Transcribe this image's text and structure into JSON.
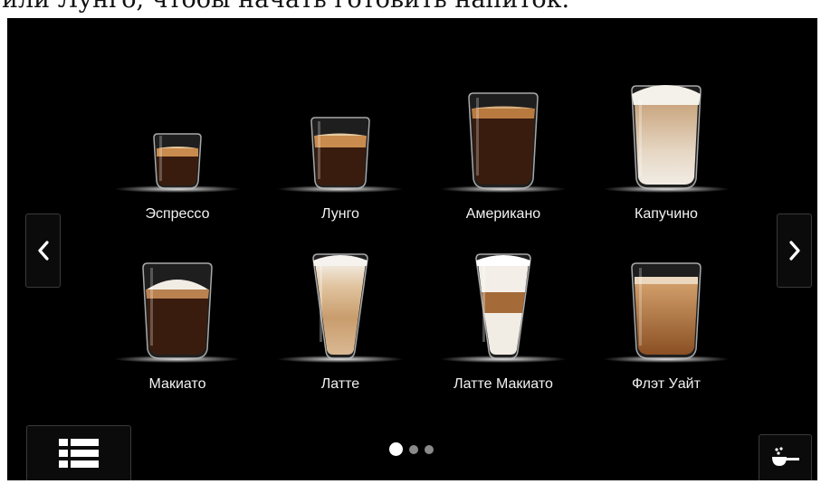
{
  "caption": {
    "text": "или Лунго, чтобы начать готовить напиток."
  },
  "beverages": [
    {
      "label": "Эспрессо"
    },
    {
      "label": "Лунго"
    },
    {
      "label": "Американо"
    },
    {
      "label": "Капучино"
    },
    {
      "label": "Макиато"
    },
    {
      "label": "Латте"
    },
    {
      "label": "Латте Макиато"
    },
    {
      "label": "Флэт Уайт"
    }
  ],
  "navigation": {
    "prev_icon": "chevron-left-icon",
    "next_icon": "chevron-right-icon"
  },
  "menu_button": {
    "icon": "list-icon"
  },
  "scoop_button": {
    "icon": "coffee-scoop-icon"
  },
  "pager": {
    "page_count": 3,
    "current_page": 1
  },
  "colors": {
    "background": "#000000",
    "label": "#f2f2f2",
    "coffee_dark": "#3a1c0e",
    "crema": "#c98b4e",
    "milk_foam": "#f1ece4",
    "dot_active": "#ffffff",
    "dot_inactive": "#8a8a8a"
  }
}
